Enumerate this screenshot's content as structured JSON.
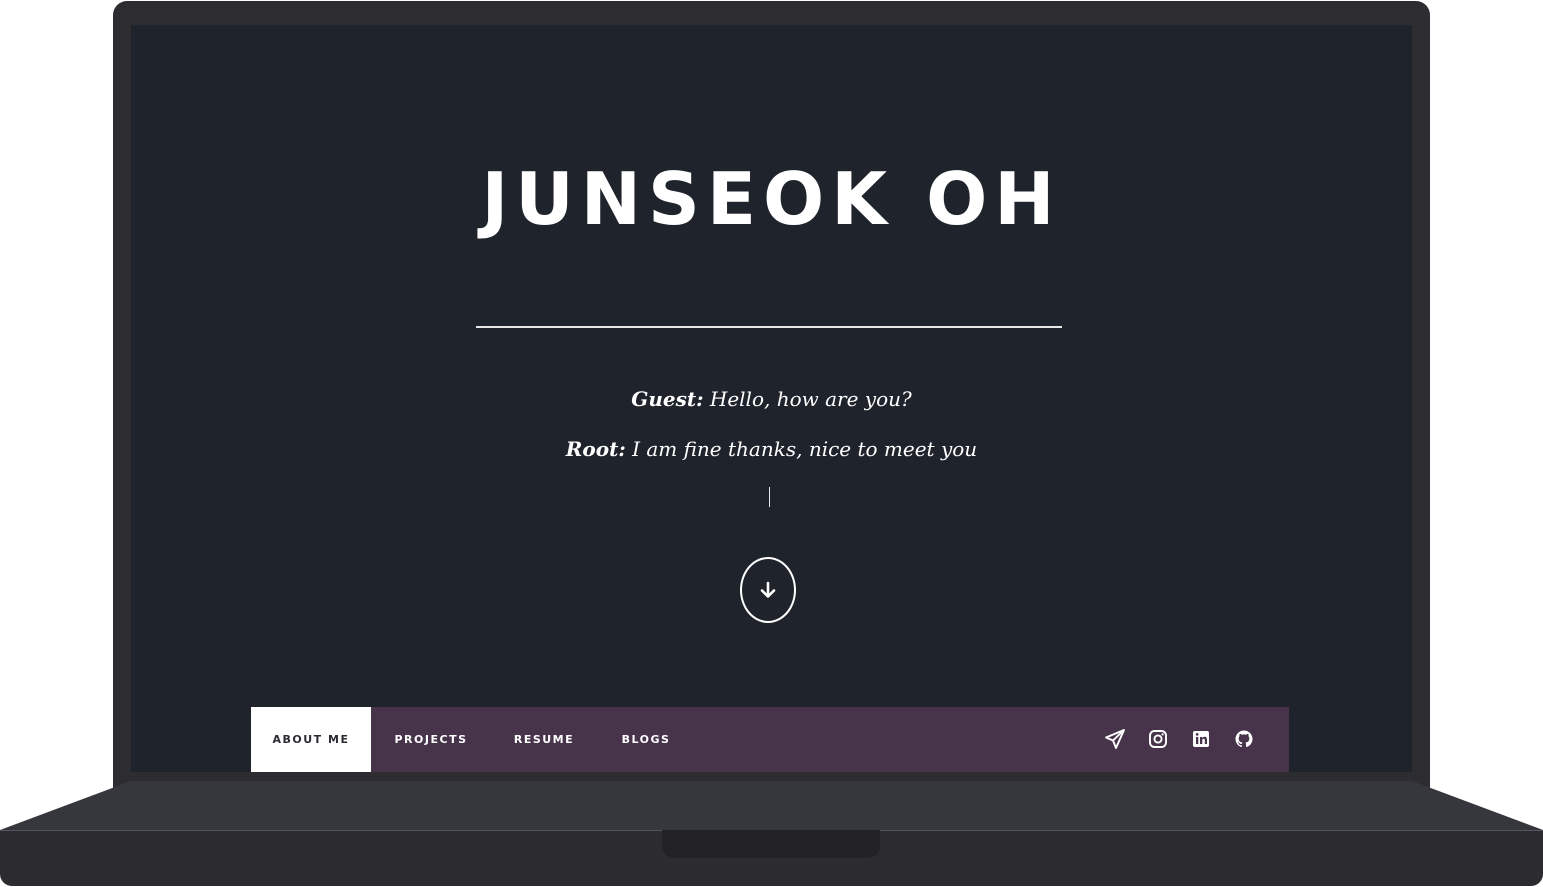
{
  "hero": {
    "title": "JUNSEOK OH"
  },
  "dialog": [
    {
      "speaker": "Guest:",
      "text": " Hello, how are you?"
    },
    {
      "speaker": "Root:",
      "text": " I am fine thanks, nice to meet you"
    }
  ],
  "scroll_button": {
    "icon": "arrow-down-icon"
  },
  "nav": {
    "items": [
      {
        "label": "ABOUT ME",
        "active": true
      },
      {
        "label": "PROJECTS",
        "active": false
      },
      {
        "label": "RESUME",
        "active": false
      },
      {
        "label": "BLOGS",
        "active": false
      }
    ]
  },
  "social": [
    {
      "icon": "telegram-icon"
    },
    {
      "icon": "instagram-icon"
    },
    {
      "icon": "linkedin-icon"
    },
    {
      "icon": "github-icon"
    }
  ],
  "colors": {
    "screen_background": "#1f242c",
    "nav_background": "#47344b",
    "nav_active_background": "#ffffff",
    "text": "#ffffff",
    "laptop_frame": "#2c2c31"
  }
}
